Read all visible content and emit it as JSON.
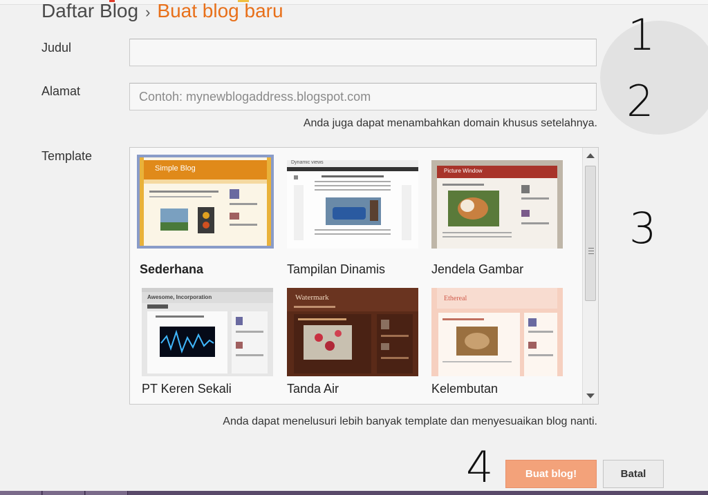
{
  "breadcrumb": {
    "parent": "Daftar Blog",
    "separator": "›",
    "current": "Buat blog baru"
  },
  "form": {
    "title_label": "Judul",
    "title_value": "",
    "address_label": "Alamat",
    "address_placeholder": "Contoh: mynewblogaddress.blogspot.com",
    "address_hint": "Anda juga dapat menambahkan domain khusus setelahnya.",
    "template_label": "Template",
    "template_hint": "Anda dapat menelusuri lebih banyak template dan menyesuaikan blog nanti."
  },
  "templates": [
    {
      "name": "Sederhana",
      "header": "Simple Blog",
      "selected": true
    },
    {
      "name": "Tampilan Dinamis",
      "header": "Dynamic views",
      "selected": false
    },
    {
      "name": "Jendela Gambar",
      "header": "Picture Window",
      "selected": false
    },
    {
      "name": "PT Keren Sekali",
      "header": "Awesome, Incorporation",
      "selected": false
    },
    {
      "name": "Tanda Air",
      "header": "Watermark",
      "selected": false
    },
    {
      "name": "Kelembutan",
      "header": "Ethereal",
      "selected": false
    }
  ],
  "buttons": {
    "create": "Buat blog!",
    "cancel": "Batal"
  },
  "annotations": [
    "1",
    "2",
    "3",
    "4"
  ],
  "colors": {
    "accent": "#e8701a",
    "create_button": "#f3a27a",
    "selection": "#8a9cc8"
  }
}
